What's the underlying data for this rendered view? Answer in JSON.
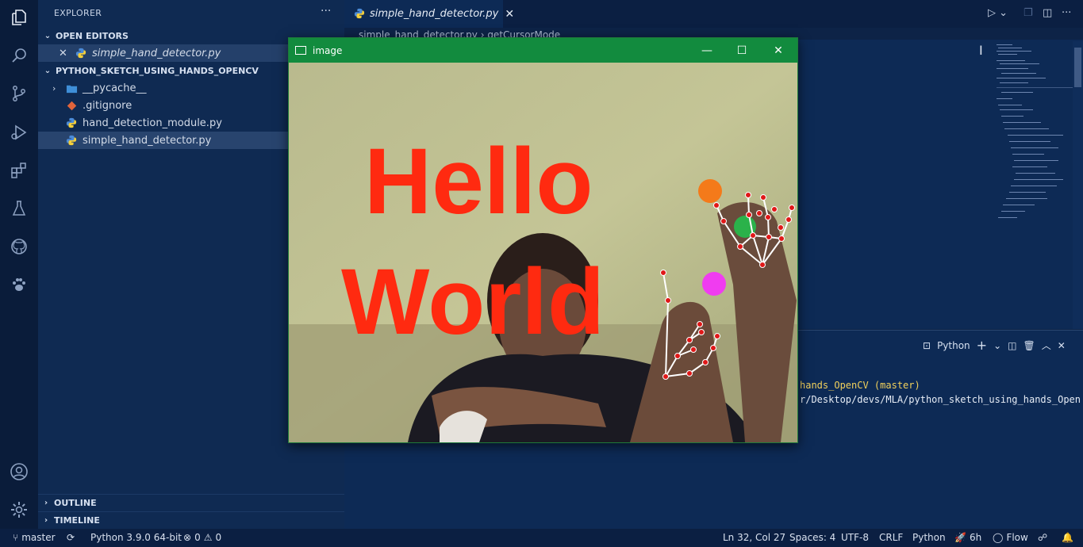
{
  "explorer": {
    "title": "EXPLORER",
    "more": "···",
    "open_editors_label": "OPEN EDITORS",
    "open_editor_file": "simple_hand_detector.py",
    "project_label": "PYTHON_SKETCH_USING_HANDS_OPENCV",
    "files": [
      {
        "name": "__pycache__",
        "kind": "folder"
      },
      {
        "name": ".gitignore",
        "kind": "git"
      },
      {
        "name": "hand_detection_module.py",
        "kind": "python"
      },
      {
        "name": "simple_hand_detector.py",
        "kind": "python"
      }
    ],
    "outline_label": "OUTLINE",
    "timeline_label": "TIMELINE"
  },
  "editor": {
    "tab_label": "simple_hand_detector.py",
    "breadcrumb": "simple_hand_detector.py  ›  getCursorMode"
  },
  "panel": {
    "terminal_type": "Python",
    "lines": [
      {
        "text": "hands_OpenCV",
        "suffix": " (master)"
      },
      {
        "text": "r/Desktop/devs/MLA/python_sketch_using_hands_Open"
      }
    ]
  },
  "image_window": {
    "title": "image",
    "drawn_text_line1": "Hello",
    "drawn_text_line2": "World"
  },
  "status": {
    "branch": "master",
    "python": "Python 3.9.0 64-bit",
    "errors": "0",
    "warnings": "0",
    "position": "Ln 32, Col 27",
    "spaces": "Spaces: 4",
    "encoding": "UTF-8",
    "eol": "CRLF",
    "language": "Python",
    "time": "6h",
    "flow": "Flow"
  },
  "colors": {
    "accent": "#128b3e",
    "ink": "#ff2a10",
    "status_bg": "#0b1f42",
    "sidebar_bg": "#0f2a52"
  }
}
